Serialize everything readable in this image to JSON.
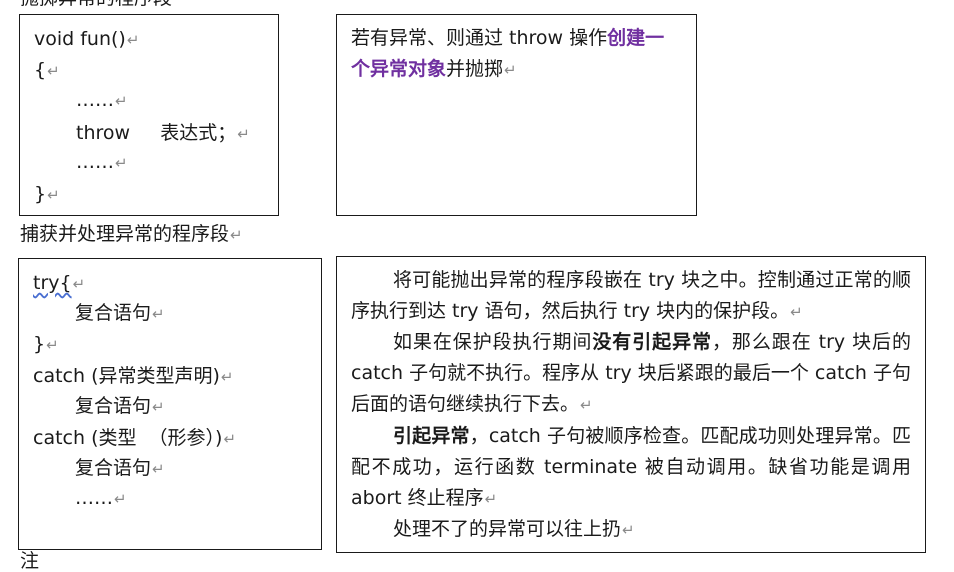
{
  "top_clip": "抛掷异常的程序段",
  "box1": {
    "lines": [
      "void fun()",
      "{",
      "……",
      "throw     表达式；",
      "……",
      "}"
    ],
    "mark": "↵"
  },
  "box2": {
    "p1_a": "若有异常、则通过 throw 操作",
    "p1_b": "创建一",
    "p2_b": "个异常对象",
    "p2_c": "并抛掷"
  },
  "caption2": "捕获并处理异常的程序段",
  "box3": {
    "lines": [
      "try{",
      "复合语句",
      "}",
      "catch (异常类型声明)",
      "复合语句",
      "catch (类型  （形参）)",
      "复合语句",
      "……"
    ]
  },
  "box4": {
    "para1": "将可能抛出异常的程序段嵌在 try 块之中。控制通过正常的顺序执行到达 try 语句，然后执行 try 块内的保护段。",
    "para2_a": "如果在保护段执行期间",
    "para2_b": "没有引起异常",
    "para2_c": "，那么跟在 try 块后的 catch 子句就不执行。程序从 try 块后紧跟的最后一个 catch 子句后面的语句继续执行下去。",
    "para3_a": "引起异常",
    "para3_b": "，catch 子句被顺序检查。匹配成功则处理异常。匹配不成功，运行函数 terminate 被自动调用。缺省功能是调用 abort 终止程序",
    "para4": "处理不了的异常可以往上扔"
  },
  "bottom_clip": "注"
}
